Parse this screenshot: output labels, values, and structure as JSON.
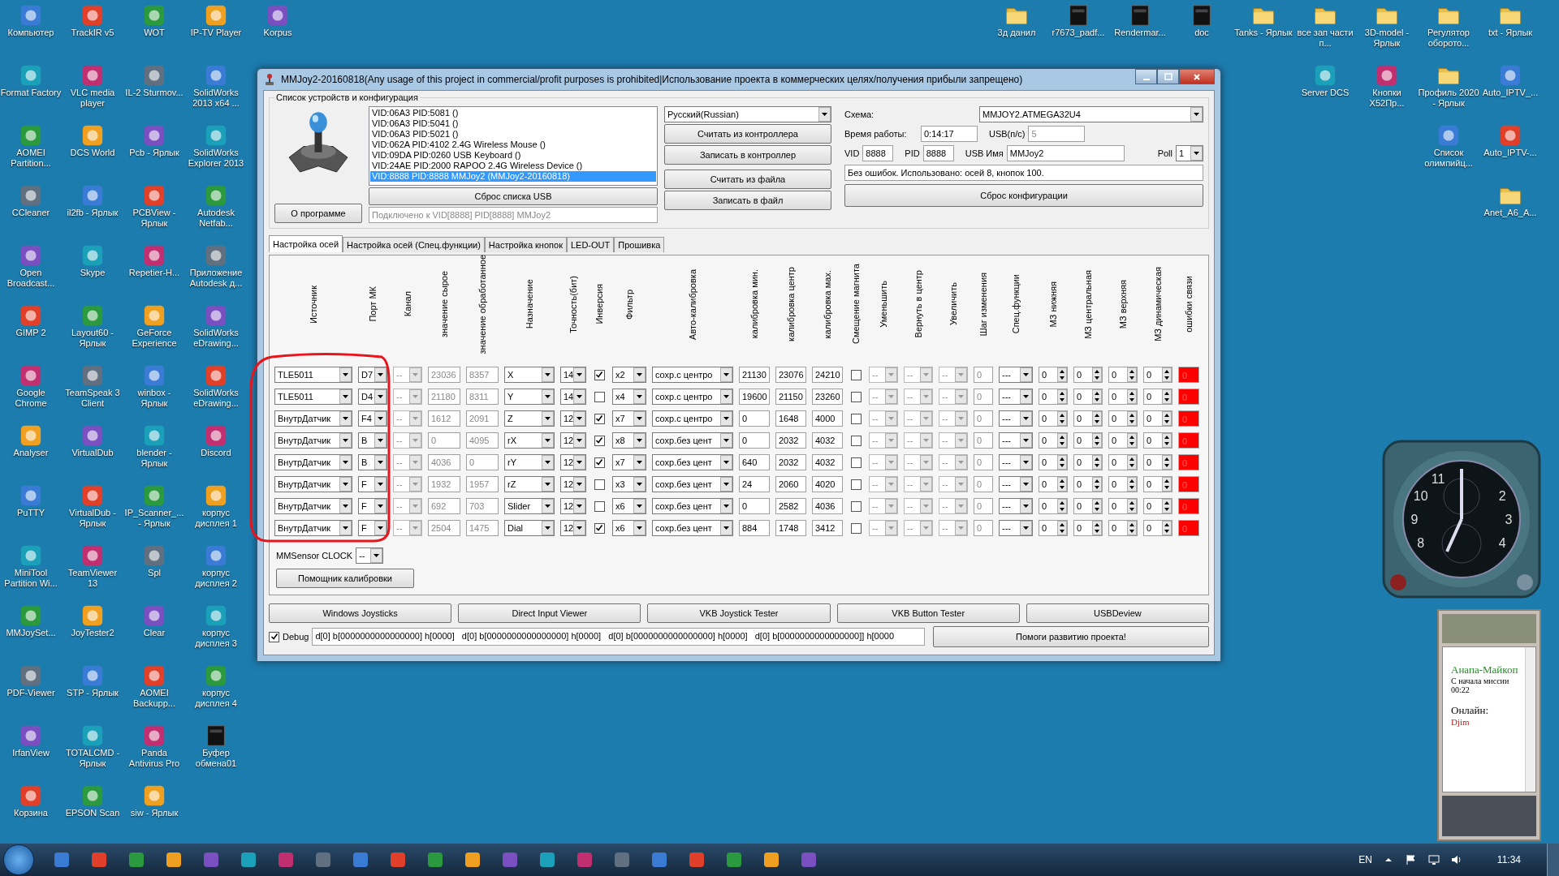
{
  "desktop": {
    "left_icon_rows": [
      [
        {
          "label": "Компьютер",
          "kind": "app"
        },
        {
          "label": "TrackIR v5",
          "kind": "app"
        },
        {
          "label": "WOT",
          "kind": "app"
        },
        {
          "label": "IP-TV Player",
          "kind": "app"
        },
        {
          "label": "Korpus",
          "kind": "app"
        }
      ],
      [
        {
          "label": "Format Factory",
          "kind": "app"
        },
        {
          "label": "VLC media player",
          "kind": "app"
        },
        {
          "label": "IL-2 Sturmov...",
          "kind": "app"
        },
        {
          "label": "SolidWorks 2013 x64 ...",
          "kind": "app"
        }
      ],
      [
        {
          "label": "AOMEI Partition...",
          "kind": "app"
        },
        {
          "label": "DCS World",
          "kind": "app"
        },
        {
          "label": "Pcb - Ярлык",
          "kind": "app"
        },
        {
          "label": "SolidWorks Explorer 2013",
          "kind": "app"
        }
      ],
      [
        {
          "label": "CCleaner",
          "kind": "app"
        },
        {
          "label": "il2fb - Ярлык",
          "kind": "app"
        },
        {
          "label": "PCBView - Ярлык",
          "kind": "app"
        },
        {
          "label": "Autodesk Netfab...",
          "kind": "app"
        }
      ],
      [
        {
          "label": "Open Broadcast...",
          "kind": "app"
        },
        {
          "label": "Skype",
          "kind": "app"
        },
        {
          "label": "Repetier-H...",
          "kind": "app"
        },
        {
          "label": "Приложение Autodesk д...",
          "kind": "app"
        }
      ],
      [
        {
          "label": "GIMP 2",
          "kind": "app"
        },
        {
          "label": "Layout60 - Ярлык",
          "kind": "app"
        },
        {
          "label": "GeForce Experience",
          "kind": "app"
        },
        {
          "label": "SolidWorks eDrawing...",
          "kind": "app"
        }
      ],
      [
        {
          "label": "Google Chrome",
          "kind": "app"
        },
        {
          "label": "TeamSpeak 3 Client",
          "kind": "app"
        },
        {
          "label": "winbox - Ярлык",
          "kind": "app"
        },
        {
          "label": "SolidWorks eDrawing...",
          "kind": "app"
        }
      ],
      [
        {
          "label": "Analyser",
          "kind": "app"
        },
        {
          "label": "VirtualDub",
          "kind": "app"
        },
        {
          "label": "blender - Ярлык",
          "kind": "app"
        },
        {
          "label": "Discord",
          "kind": "app"
        }
      ],
      [
        {
          "label": "PuTTY",
          "kind": "app"
        },
        {
          "label": "VirtualDub - Ярлык",
          "kind": "app"
        },
        {
          "label": "IP_Scanner_... - Ярлык",
          "kind": "app"
        },
        {
          "label": "корпус дисплея 1",
          "kind": "app"
        }
      ],
      [
        {
          "label": "MiniTool Partition Wi...",
          "kind": "app"
        },
        {
          "label": "TeamViewer 13",
          "kind": "app"
        },
        {
          "label": "Spl",
          "kind": "app"
        },
        {
          "label": "корпус дисплея 2",
          "kind": "app"
        }
      ],
      [
        {
          "label": "MMJoySet...",
          "kind": "app"
        },
        {
          "label": "JoyTester2",
          "kind": "app"
        },
        {
          "label": "Clear",
          "kind": "app"
        },
        {
          "label": "корпус дисплея 3",
          "kind": "app"
        }
      ],
      [
        {
          "label": "PDF-Viewer",
          "kind": "app"
        },
        {
          "label": "STP - Ярлык",
          "kind": "app"
        },
        {
          "label": "AOMEI Backupp...",
          "kind": "app"
        },
        {
          "label": "корпус дисплея 4",
          "kind": "app"
        }
      ],
      [
        {
          "label": "IrfanView",
          "kind": "app"
        },
        {
          "label": "TOTALCMD - Ярлык",
          "kind": "app"
        },
        {
          "label": "Panda Antivirus Pro",
          "kind": "app"
        },
        {
          "label": "Буфер обмена01",
          "kind": "file"
        }
      ],
      [
        {
          "label": "Корзина",
          "kind": "app"
        },
        {
          "label": "EPSON Scan",
          "kind": "app"
        },
        {
          "label": "siw - Ярлык",
          "kind": "app"
        }
      ]
    ],
    "right_icon_rows": [
      [
        {
          "label": "3д данил",
          "kind": "folder"
        },
        {
          "label": "r7673_padf...",
          "kind": "file"
        },
        {
          "label": "Rendermar...",
          "kind": "file"
        },
        {
          "label": "doc",
          "kind": "file"
        },
        {
          "label": "Tanks - Ярлык",
          "kind": "folder"
        },
        {
          "label": "все зап части п...",
          "kind": "folder"
        },
        {
          "label": "3D-model - Ярлык",
          "kind": "folder"
        },
        {
          "label": "Регулятор оборото...",
          "kind": "folder"
        },
        {
          "label": "txt - Ярлык",
          "kind": "folder"
        }
      ],
      [
        {
          "label": "Server DCS",
          "kind": "app"
        },
        {
          "label": "Кнопки X52Пр...",
          "kind": "app"
        },
        {
          "label": "Профиль 2020 - Ярлык",
          "kind": "folder"
        },
        {
          "label": "Auto_IPTV_...",
          "kind": "app"
        }
      ],
      [
        {
          "label": "Список олимпийц...",
          "kind": "app"
        },
        {
          "label": "Auto_IPTV-...",
          "kind": "app"
        }
      ],
      [
        {
          "label": "Anet_A6_A...",
          "kind": "folder"
        }
      ]
    ]
  },
  "window": {
    "title": "MMJoy2-20160818(Any usage of this project in commercial/profit purposes is prohibited|Использование проекта в коммерческих целях/получения прибыли запрещено)"
  },
  "devices": {
    "group_title": "Список устройств и конфигурация",
    "items": [
      {
        "text": "VID:06A3 PID:5081  ()",
        "selected": false
      },
      {
        "text": "VID:06A3 PID:5041  ()",
        "selected": false
      },
      {
        "text": "VID:06A3 PID:5021  ()",
        "selected": false
      },
      {
        "text": "VID:062A PID:4102 2.4G Wireless Mouse ()",
        "selected": false
      },
      {
        "text": "VID:09DA PID:0260 USB Keyboard ()",
        "selected": false
      },
      {
        "text": "VID:24AE PID:2000 RAPOO 2.4G Wireless Device ()",
        "selected": false
      },
      {
        "text": "VID:8888 PID:8888 MMJoy2 (MMJoy2-20160818)",
        "selected": true
      }
    ],
    "reset_button": "Сброс списка USB",
    "about_button": "О программе",
    "connection": "Подключено к VID[8888] PID[8888] MMJoy2"
  },
  "controller": {
    "language": "Русский(Russian)",
    "buttons": [
      "Считать из контроллера",
      "Записать в контроллер",
      "Считать из файла",
      "Записать в файл"
    ]
  },
  "config": {
    "scheme_label": "Схема:",
    "scheme": "MMJOY2.ATMEGA32U4",
    "uptime_label": "Время работы:",
    "uptime": "0:14:17",
    "usb_rate_label": "USB(п/с)",
    "usb_rate": "5",
    "usb_rate_disabled": true,
    "vid_label": "VID",
    "vid": "8888",
    "pid_label": "PID",
    "pid": "8888",
    "usb_name_label": "USB Имя",
    "usb_name": "MMJoy2",
    "poll_label": "Poll",
    "poll": "1",
    "status": "Без ошибок. Использовано: осей  8, кнопок  100.",
    "reset_button": "Сброс конфигурации"
  },
  "tabs": [
    {
      "label": "Настройка осей",
      "selected": true
    },
    {
      "label": "Настройка осей (Спец.функции)",
      "selected": false
    },
    {
      "label": "Настройка кнопок",
      "selected": false
    },
    {
      "label": "LED-OUT",
      "selected": false
    },
    {
      "label": "Прошивка",
      "selected": false
    }
  ],
  "table": {
    "columns": [
      "Источник",
      "Порт МК",
      "Канал",
      "значение сырое",
      "значение обработанное",
      "Назначение",
      "Точность(бит)",
      "Инверсия",
      "Фильтр",
      "Авто-калибровка",
      "калибровка мин.",
      "калибровка центр",
      "калибровка мах.",
      "Смещение магнита",
      "Уменьшить",
      "Вернуть в центр",
      "Увеличить",
      "Шаг изменения",
      "Спец.функции",
      "МЗ нижняя",
      "МЗ центральная",
      "МЗ верхняя",
      "МЗ динамическая",
      "ошибки связи"
    ],
    "rows": [
      {
        "source": "TLE5011",
        "port": "D7",
        "channel": "--",
        "raw": "23036",
        "processed": "8357",
        "assign": "X",
        "bits": "14",
        "inverted": true,
        "filter": "x2",
        "autocal": "сохр.с центро",
        "cal_min": "21130",
        "cal_center": "23076",
        "cal_max": "24210",
        "magnet_offset": false,
        "decrease": "--",
        "to_center": "--",
        "increase": "--",
        "step": "0",
        "special": "---",
        "mz_low": "0",
        "mz_center": "0",
        "mz_high": "0",
        "mz_dynamic": "0",
        "errors": "0",
        "alarm": true
      },
      {
        "source": "TLE5011",
        "port": "D4",
        "channel": "--",
        "raw": "21180",
        "processed": "8311",
        "assign": "Y",
        "bits": "14",
        "inverted": false,
        "filter": "x4",
        "autocal": "сохр.с центро",
        "cal_min": "19600",
        "cal_center": "21150",
        "cal_max": "23260",
        "magnet_offset": false,
        "decrease": "--",
        "to_center": "--",
        "increase": "--",
        "step": "0",
        "special": "---",
        "mz_low": "0",
        "mz_center": "0",
        "mz_high": "0",
        "mz_dynamic": "0",
        "errors": "0",
        "alarm": true
      },
      {
        "source": "ВнутрДатчик",
        "port": "F4",
        "channel": "--",
        "raw": "1612",
        "processed": "2091",
        "assign": "Z",
        "bits": "12",
        "inverted": true,
        "filter": "x7",
        "autocal": "сохр.с центро",
        "cal_min": "0",
        "cal_center": "1648",
        "cal_max": "4000",
        "magnet_offset": false,
        "decrease": "--",
        "to_center": "--",
        "increase": "--",
        "step": "0",
        "special": "---",
        "mz_low": "0",
        "mz_center": "0",
        "mz_high": "0",
        "mz_dynamic": "0",
        "errors": "0",
        "alarm": true
      },
      {
        "source": "ВнутрДатчик",
        "port": "B",
        "channel": "--",
        "raw": "0",
        "processed": "4095",
        "assign": "rX",
        "bits": "12",
        "inverted": true,
        "filter": "x8",
        "autocal": "сохр.без цент",
        "cal_min": "0",
        "cal_center": "2032",
        "cal_max": "4032",
        "magnet_offset": false,
        "decrease": "--",
        "to_center": "--",
        "increase": "--",
        "step": "0",
        "special": "---",
        "mz_low": "0",
        "mz_center": "0",
        "mz_high": "0",
        "mz_dynamic": "0",
        "errors": "0",
        "alarm": true
      },
      {
        "source": "ВнутрДатчик",
        "port": "B",
        "channel": "--",
        "raw": "4036",
        "processed": "0",
        "assign": "rY",
        "bits": "12",
        "inverted": true,
        "filter": "x7",
        "autocal": "сохр.без цент",
        "cal_min": "640",
        "cal_center": "2032",
        "cal_max": "4032",
        "magnet_offset": false,
        "decrease": "--",
        "to_center": "--",
        "increase": "--",
        "step": "0",
        "special": "---",
        "mz_low": "0",
        "mz_center": "0",
        "mz_high": "0",
        "mz_dynamic": "0",
        "errors": "0",
        "alarm": true
      },
      {
        "source": "ВнутрДатчик",
        "port": "F",
        "channel": "--",
        "raw": "1932",
        "processed": "1957",
        "assign": "rZ",
        "bits": "12",
        "inverted": false,
        "filter": "x3",
        "autocal": "сохр.без цент",
        "cal_min": "24",
        "cal_center": "2060",
        "cal_max": "4020",
        "magnet_offset": false,
        "decrease": "--",
        "to_center": "--",
        "increase": "--",
        "step": "0",
        "special": "---",
        "mz_low": "0",
        "mz_center": "0",
        "mz_high": "0",
        "mz_dynamic": "0",
        "errors": "0",
        "alarm": true
      },
      {
        "source": "ВнутрДатчик",
        "port": "F",
        "channel": "--",
        "raw": "692",
        "processed": "703",
        "assign": "Slider",
        "bits": "12",
        "inverted": false,
        "filter": "x6",
        "autocal": "сохр.без цент",
        "cal_min": "0",
        "cal_center": "2582",
        "cal_max": "4036",
        "magnet_offset": false,
        "decrease": "--",
        "to_center": "--",
        "increase": "--",
        "step": "0",
        "special": "---",
        "mz_low": "0",
        "mz_center": "0",
        "mz_high": "0",
        "mz_dynamic": "0",
        "errors": "0",
        "alarm": true
      },
      {
        "source": "ВнутрДатчик",
        "port": "F",
        "channel": "--",
        "raw": "2504",
        "processed": "1475",
        "assign": "Dial",
        "bits": "12",
        "inverted": true,
        "filter": "x6",
        "autocal": "сохр.без цент",
        "cal_min": "884",
        "cal_center": "1748",
        "cal_max": "3412",
        "magnet_offset": false,
        "decrease": "--",
        "to_center": "--",
        "increase": "--",
        "step": "0",
        "special": "---",
        "mz_low": "0",
        "mz_center": "0",
        "mz_high": "0",
        "mz_dynamic": "0",
        "errors": "0",
        "alarm": true
      }
    ]
  },
  "sensor": {
    "label": "MMSensor CLOCK",
    "value": "--"
  },
  "calibration_button": "Помощник калибровки",
  "tool_buttons": [
    "Windows Joysticks",
    "Direct Input Viewer",
    "VKB Joystick Tester",
    "VKB Button Tester",
    "USBDeview"
  ],
  "debug": {
    "label": "Debug",
    "checked": true,
    "value": "d[0] b[0000000000000000] h[0000]   d[0] b[0000000000000000] h[0000]   d[0] b[0000000000000000] h[0000]   d[0] b[0000000000000000]] h[0000",
    "help_button": "Помоги развитию проекта!"
  },
  "clock_gadget": {
    "dial_numbers": [
      "11",
      "2",
      "3",
      "4",
      "8",
      "9",
      "10"
    ]
  },
  "chat_gadget": {
    "route": "Анапа-Майкоп",
    "since_label": "С начала миссии",
    "elapsed": "00:22",
    "online_label": "Онлайн:",
    "online_user": "Djim"
  },
  "taskbar": {
    "language": "EN",
    "time": "11:34"
  }
}
